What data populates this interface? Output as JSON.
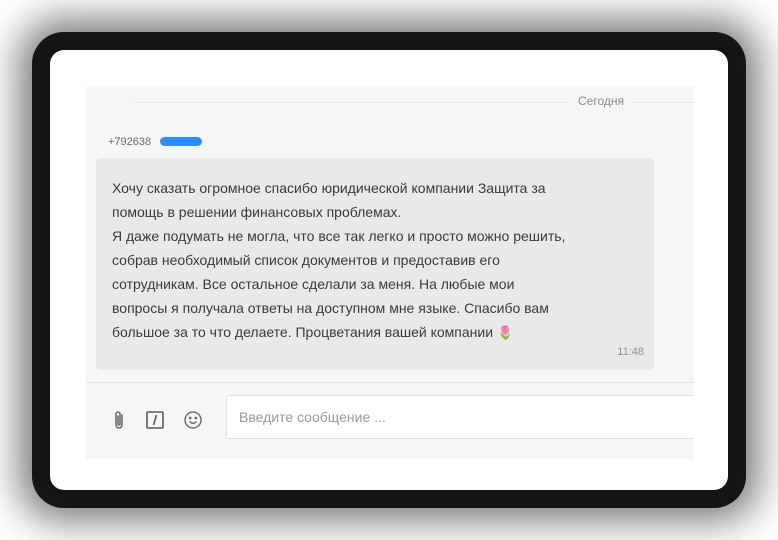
{
  "chat": {
    "date_separator": "Сегодня",
    "sender_phone": "+792638",
    "message": {
      "lines": [
        "Хочу сказать огромное спасибо юридической компании Защита за",
        "помощь в решении финансовых проблемах.",
        "Я даже подумать не могла, что все так легко и просто можно решить,",
        "собрав необходимый список документов и предоставив его",
        "сотрудникам. Все остальное сделали за меня. На любые мои",
        "вопросы я получала ответы на доступном мне языке. Спасибо вам",
        "большое за то что делаете. Процветания вашей компании"
      ],
      "emoji": "🌷",
      "time": "11:48"
    }
  },
  "composer": {
    "placeholder": "Введите сообщение ...",
    "value": "",
    "icons": [
      "paperclip-icon",
      "italic-icon",
      "smiley-icon"
    ]
  },
  "colors": {
    "redaction": "#2f8cff",
    "bubble": "#e9e9e9",
    "panel": "#f6f6f6"
  }
}
